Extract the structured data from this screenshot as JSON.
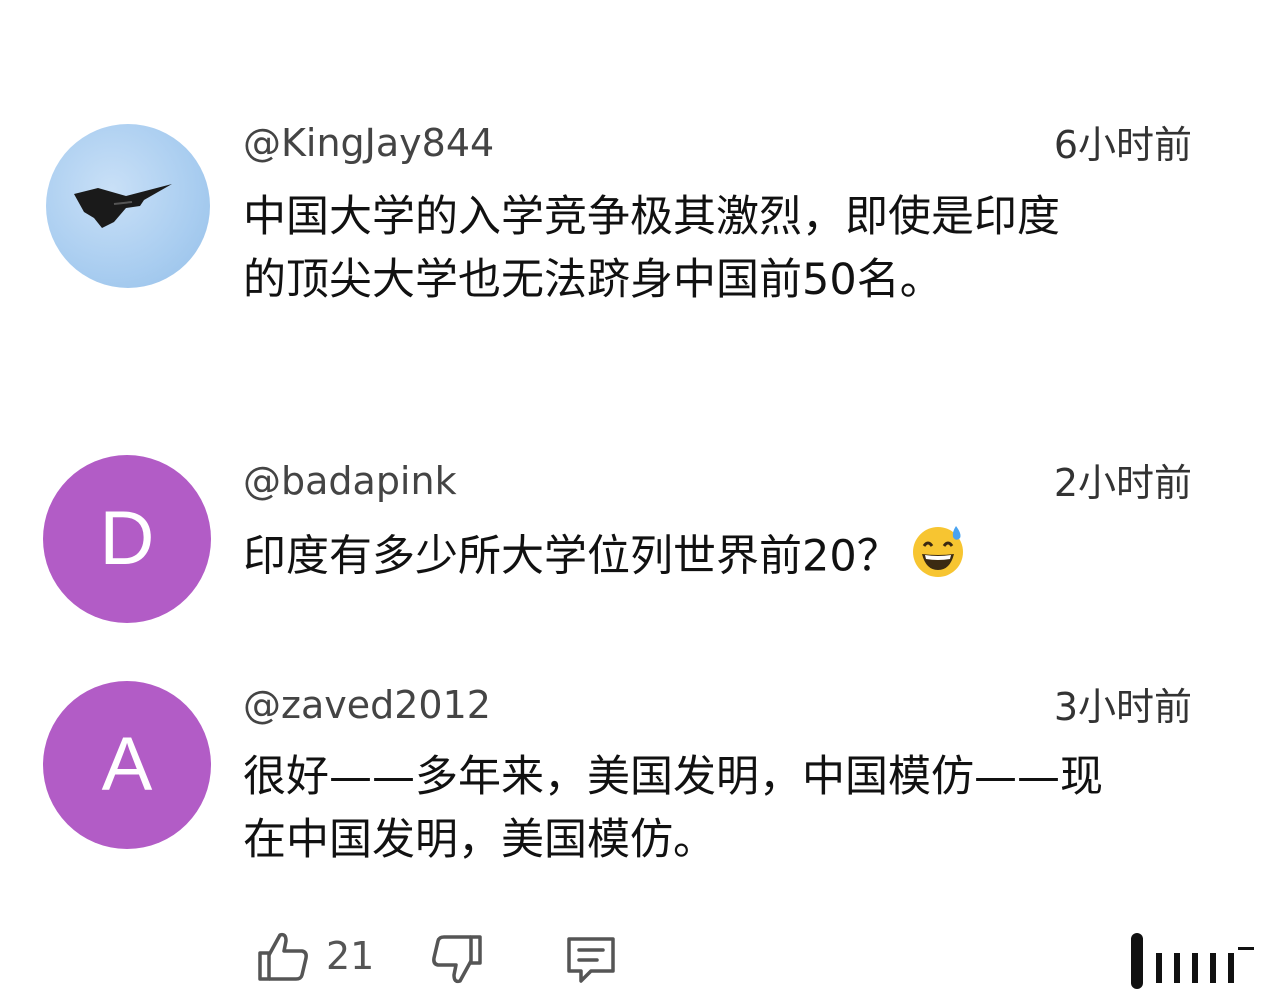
{
  "comments": [
    {
      "username": "@KingJay844",
      "time": "6小时前",
      "avatar": {
        "type": "photo",
        "icon": "jet-aircraft-icon",
        "color": "#a9cdf0"
      },
      "lines": [
        "中国大学的入学竞争极其激烈，即使是印度",
        "的顶尖大学也无法跻身中国前50名。"
      ]
    },
    {
      "username": "@badapink",
      "time": "2小时前",
      "avatar": {
        "type": "letter",
        "letter": "D",
        "color": "#b25cc6"
      },
      "text": "印度有多少所大学位列世界前20？",
      "emoji": "grinning-sweat-emoji"
    },
    {
      "username": "@zaved2012",
      "time": "3小时前",
      "avatar": {
        "type": "letter",
        "letter": "A",
        "color": "#b25cc6"
      },
      "lines": [
        "很好——多年来，美国发明，中国模仿——现",
        "在中国发明，美国模仿。"
      ]
    }
  ],
  "actions": {
    "like_count": "21",
    "icons": [
      "thumbs-up-icon",
      "thumbs-down-icon",
      "reply-icon"
    ]
  }
}
